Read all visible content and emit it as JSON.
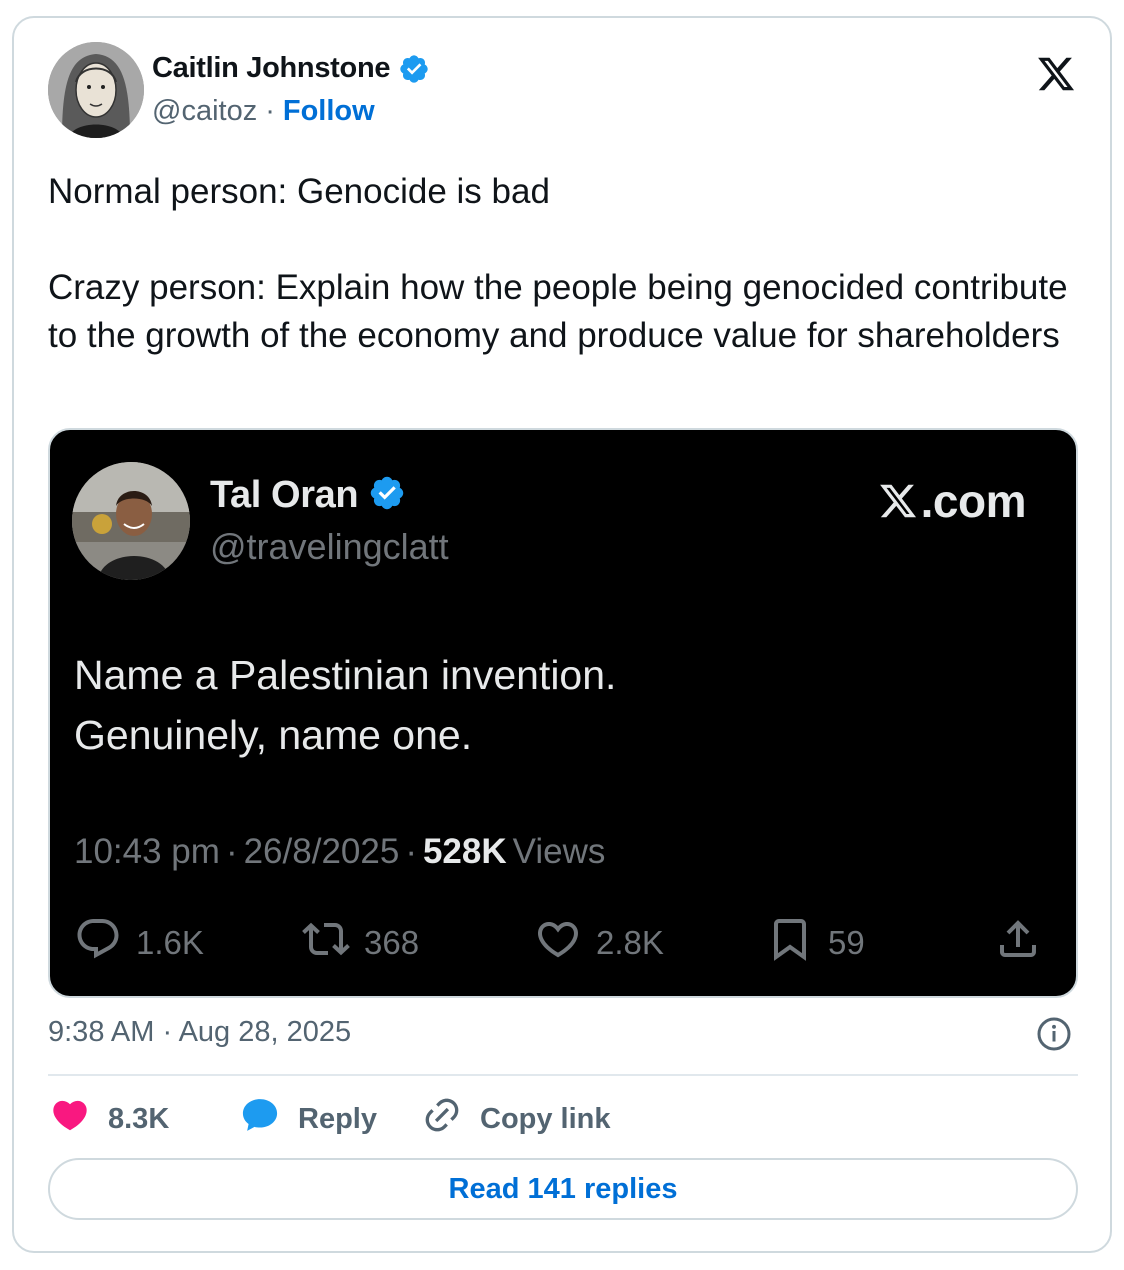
{
  "author": {
    "name": "Caitlin Johnstone",
    "handle": "@caitoz",
    "separator": "·",
    "follow_label": "Follow"
  },
  "tweet": {
    "paragraphs": [
      "Normal person: Genocide is bad",
      "Crazy person: Explain how the people being genocided contribute to the growth of the economy and produce value for shareholders"
    ],
    "timestamp": "9:38 AM · Aug 28, 2025"
  },
  "embed": {
    "name": "Tal Oran",
    "handle": "@travelingclatt",
    "brand": ".com",
    "lines": [
      "Name a Palestinian invention.",
      "Genuinely, name one."
    ],
    "time": "10:43 pm",
    "date": "26/8/2025",
    "separator": "·",
    "views_count": "528K",
    "views_label": "Views",
    "replies": "1.6K",
    "reposts": "368",
    "likes": "2.8K",
    "bookmarks": "59"
  },
  "actions": {
    "likes": "8.3K",
    "reply_label": "Reply",
    "copy_label": "Copy link",
    "read_replies_label": "Read 141 replies"
  },
  "colors": {
    "link_blue": "#006fd6",
    "verified_blue": "#1d9bf0",
    "like_pink": "#f91880",
    "muted": "#536471"
  },
  "icons": [
    "verified-badge-icon",
    "x-logo-icon",
    "reply-icon",
    "repost-icon",
    "heart-icon",
    "bookmark-icon",
    "share-icon",
    "info-icon",
    "speech-bubble-icon",
    "link-icon"
  ]
}
